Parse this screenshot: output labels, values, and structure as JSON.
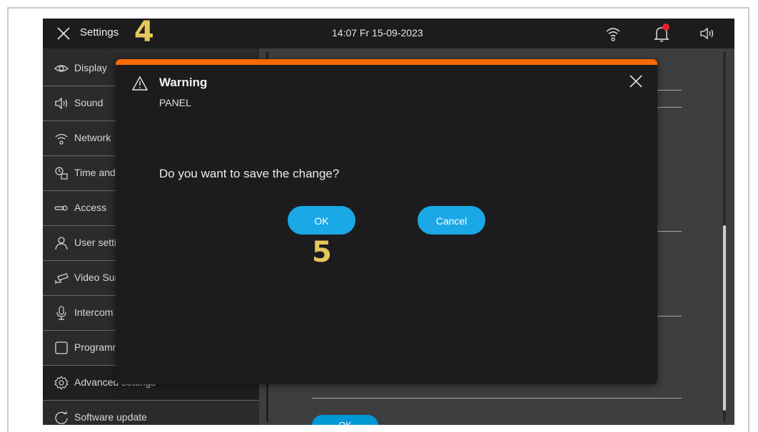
{
  "topbar": {
    "title": "Settings",
    "step_marker": "4",
    "datetime": "14:07  Fr 15-09-2023",
    "icons": [
      "close-icon",
      "wifi-icon",
      "bell-icon",
      "speaker-icon"
    ],
    "notification_color": "#e5222a"
  },
  "sidebar": {
    "items": [
      {
        "label": "Display",
        "icon": "eye-icon"
      },
      {
        "label": "Sound",
        "icon": "speaker-icon"
      },
      {
        "label": "Network",
        "icon": "wifi-icon"
      },
      {
        "label": "Time and date",
        "icon": "clock-calendar-icon"
      },
      {
        "label": "Access",
        "icon": "key-icon"
      },
      {
        "label": "User settings",
        "icon": "user-icon"
      },
      {
        "label": "Video Surveillance",
        "icon": "camera-icon"
      },
      {
        "label": "Intercom",
        "icon": "microphone-icon"
      },
      {
        "label": "Programming",
        "icon": "square-icon"
      },
      {
        "label": "Advanced settings",
        "icon": "gear-icon",
        "active": true
      },
      {
        "label": "Software update",
        "icon": "refresh-icon"
      }
    ]
  },
  "main": {
    "ok_label": "OK"
  },
  "dialog": {
    "title": "Warning",
    "subtitle": "PANEL",
    "question": "Do you want to save the change?",
    "ok_label": "OK",
    "cancel_label": "Cancel",
    "step_marker": "5",
    "accent_color": "#ff6a00",
    "button_color": "#1aa8e6"
  },
  "colors": {
    "marker": "#e6c75a",
    "background": "#3e3e40"
  }
}
